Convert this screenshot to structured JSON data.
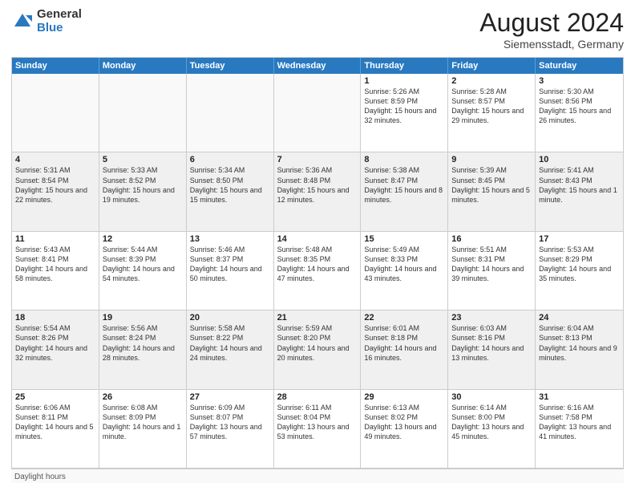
{
  "header": {
    "logo_general": "General",
    "logo_blue": "Blue",
    "month_title": "August 2024",
    "location": "Siemensstadt, Germany"
  },
  "days_of_week": [
    "Sunday",
    "Monday",
    "Tuesday",
    "Wednesday",
    "Thursday",
    "Friday",
    "Saturday"
  ],
  "note": "Daylight hours",
  "weeks": [
    [
      {
        "day": "",
        "sunrise": "",
        "sunset": "",
        "daylight": "",
        "empty": true
      },
      {
        "day": "",
        "sunrise": "",
        "sunset": "",
        "daylight": "",
        "empty": true
      },
      {
        "day": "",
        "sunrise": "",
        "sunset": "",
        "daylight": "",
        "empty": true
      },
      {
        "day": "",
        "sunrise": "",
        "sunset": "",
        "daylight": "",
        "empty": true
      },
      {
        "day": "1",
        "sunrise": "Sunrise: 5:26 AM",
        "sunset": "Sunset: 8:59 PM",
        "daylight": "Daylight: 15 hours and 32 minutes.",
        "empty": false
      },
      {
        "day": "2",
        "sunrise": "Sunrise: 5:28 AM",
        "sunset": "Sunset: 8:57 PM",
        "daylight": "Daylight: 15 hours and 29 minutes.",
        "empty": false
      },
      {
        "day": "3",
        "sunrise": "Sunrise: 5:30 AM",
        "sunset": "Sunset: 8:56 PM",
        "daylight": "Daylight: 15 hours and 26 minutes.",
        "empty": false
      }
    ],
    [
      {
        "day": "4",
        "sunrise": "Sunrise: 5:31 AM",
        "sunset": "Sunset: 8:54 PM",
        "daylight": "Daylight: 15 hours and 22 minutes.",
        "empty": false
      },
      {
        "day": "5",
        "sunrise": "Sunrise: 5:33 AM",
        "sunset": "Sunset: 8:52 PM",
        "daylight": "Daylight: 15 hours and 19 minutes.",
        "empty": false
      },
      {
        "day": "6",
        "sunrise": "Sunrise: 5:34 AM",
        "sunset": "Sunset: 8:50 PM",
        "daylight": "Daylight: 15 hours and 15 minutes.",
        "empty": false
      },
      {
        "day": "7",
        "sunrise": "Sunrise: 5:36 AM",
        "sunset": "Sunset: 8:48 PM",
        "daylight": "Daylight: 15 hours and 12 minutes.",
        "empty": false
      },
      {
        "day": "8",
        "sunrise": "Sunrise: 5:38 AM",
        "sunset": "Sunset: 8:47 PM",
        "daylight": "Daylight: 15 hours and 8 minutes.",
        "empty": false
      },
      {
        "day": "9",
        "sunrise": "Sunrise: 5:39 AM",
        "sunset": "Sunset: 8:45 PM",
        "daylight": "Daylight: 15 hours and 5 minutes.",
        "empty": false
      },
      {
        "day": "10",
        "sunrise": "Sunrise: 5:41 AM",
        "sunset": "Sunset: 8:43 PM",
        "daylight": "Daylight: 15 hours and 1 minute.",
        "empty": false
      }
    ],
    [
      {
        "day": "11",
        "sunrise": "Sunrise: 5:43 AM",
        "sunset": "Sunset: 8:41 PM",
        "daylight": "Daylight: 14 hours and 58 minutes.",
        "empty": false
      },
      {
        "day": "12",
        "sunrise": "Sunrise: 5:44 AM",
        "sunset": "Sunset: 8:39 PM",
        "daylight": "Daylight: 14 hours and 54 minutes.",
        "empty": false
      },
      {
        "day": "13",
        "sunrise": "Sunrise: 5:46 AM",
        "sunset": "Sunset: 8:37 PM",
        "daylight": "Daylight: 14 hours and 50 minutes.",
        "empty": false
      },
      {
        "day": "14",
        "sunrise": "Sunrise: 5:48 AM",
        "sunset": "Sunset: 8:35 PM",
        "daylight": "Daylight: 14 hours and 47 minutes.",
        "empty": false
      },
      {
        "day": "15",
        "sunrise": "Sunrise: 5:49 AM",
        "sunset": "Sunset: 8:33 PM",
        "daylight": "Daylight: 14 hours and 43 minutes.",
        "empty": false
      },
      {
        "day": "16",
        "sunrise": "Sunrise: 5:51 AM",
        "sunset": "Sunset: 8:31 PM",
        "daylight": "Daylight: 14 hours and 39 minutes.",
        "empty": false
      },
      {
        "day": "17",
        "sunrise": "Sunrise: 5:53 AM",
        "sunset": "Sunset: 8:29 PM",
        "daylight": "Daylight: 14 hours and 35 minutes.",
        "empty": false
      }
    ],
    [
      {
        "day": "18",
        "sunrise": "Sunrise: 5:54 AM",
        "sunset": "Sunset: 8:26 PM",
        "daylight": "Daylight: 14 hours and 32 minutes.",
        "empty": false
      },
      {
        "day": "19",
        "sunrise": "Sunrise: 5:56 AM",
        "sunset": "Sunset: 8:24 PM",
        "daylight": "Daylight: 14 hours and 28 minutes.",
        "empty": false
      },
      {
        "day": "20",
        "sunrise": "Sunrise: 5:58 AM",
        "sunset": "Sunset: 8:22 PM",
        "daylight": "Daylight: 14 hours and 24 minutes.",
        "empty": false
      },
      {
        "day": "21",
        "sunrise": "Sunrise: 5:59 AM",
        "sunset": "Sunset: 8:20 PM",
        "daylight": "Daylight: 14 hours and 20 minutes.",
        "empty": false
      },
      {
        "day": "22",
        "sunrise": "Sunrise: 6:01 AM",
        "sunset": "Sunset: 8:18 PM",
        "daylight": "Daylight: 14 hours and 16 minutes.",
        "empty": false
      },
      {
        "day": "23",
        "sunrise": "Sunrise: 6:03 AM",
        "sunset": "Sunset: 8:16 PM",
        "daylight": "Daylight: 14 hours and 13 minutes.",
        "empty": false
      },
      {
        "day": "24",
        "sunrise": "Sunrise: 6:04 AM",
        "sunset": "Sunset: 8:13 PM",
        "daylight": "Daylight: 14 hours and 9 minutes.",
        "empty": false
      }
    ],
    [
      {
        "day": "25",
        "sunrise": "Sunrise: 6:06 AM",
        "sunset": "Sunset: 8:11 PM",
        "daylight": "Daylight: 14 hours and 5 minutes.",
        "empty": false
      },
      {
        "day": "26",
        "sunrise": "Sunrise: 6:08 AM",
        "sunset": "Sunset: 8:09 PM",
        "daylight": "Daylight: 14 hours and 1 minute.",
        "empty": false
      },
      {
        "day": "27",
        "sunrise": "Sunrise: 6:09 AM",
        "sunset": "Sunset: 8:07 PM",
        "daylight": "Daylight: 13 hours and 57 minutes.",
        "empty": false
      },
      {
        "day": "28",
        "sunrise": "Sunrise: 6:11 AM",
        "sunset": "Sunset: 8:04 PM",
        "daylight": "Daylight: 13 hours and 53 minutes.",
        "empty": false
      },
      {
        "day": "29",
        "sunrise": "Sunrise: 6:13 AM",
        "sunset": "Sunset: 8:02 PM",
        "daylight": "Daylight: 13 hours and 49 minutes.",
        "empty": false
      },
      {
        "day": "30",
        "sunrise": "Sunrise: 6:14 AM",
        "sunset": "Sunset: 8:00 PM",
        "daylight": "Daylight: 13 hours and 45 minutes.",
        "empty": false
      },
      {
        "day": "31",
        "sunrise": "Sunrise: 6:16 AM",
        "sunset": "Sunset: 7:58 PM",
        "daylight": "Daylight: 13 hours and 41 minutes.",
        "empty": false
      }
    ]
  ]
}
